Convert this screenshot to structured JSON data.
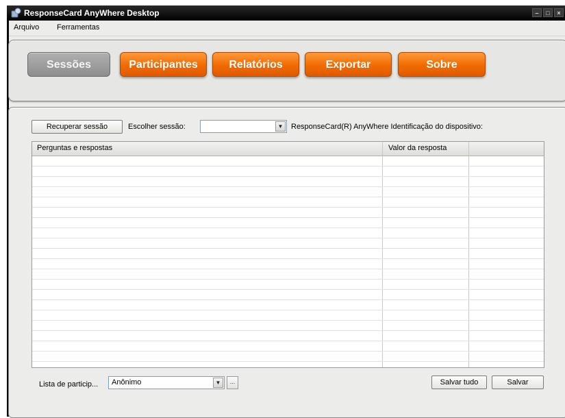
{
  "window": {
    "title": "ResponseCard AnyWhere Desktop",
    "controls": [
      "–",
      "□",
      "×"
    ]
  },
  "menu": {
    "items": [
      "Arquivo",
      "Ferramentas"
    ]
  },
  "tabs": [
    {
      "label": "Sessões",
      "active": true
    },
    {
      "label": "Participantes",
      "active": false
    },
    {
      "label": "Relatórios",
      "active": false
    },
    {
      "label": "Exportar",
      "active": false
    },
    {
      "label": "Sobre",
      "active": false
    }
  ],
  "session": {
    "recover_button": "Recuperar sessão",
    "choose_label": "Escolher sessão:",
    "choose_value": "",
    "device_label": "ResponseCard(R) AnyWhere Identificação do dispositivo:"
  },
  "table": {
    "columns": [
      "Perguntas e respostas",
      "Valor da resposta",
      ""
    ],
    "rows": []
  },
  "footer": {
    "participant_list_label": "Lista de particip...",
    "participant_list_value": "Anônimo",
    "ellipsis_label": "...",
    "save_all_button": "Salvar tudo",
    "save_button": "Salvar"
  },
  "icons": {
    "app": "app-icon",
    "dropdown": "chevron-down-icon"
  },
  "colors": {
    "tab_orange": "#f06a00",
    "tab_active": "#9a9a9a",
    "titlebar": "#000000"
  }
}
